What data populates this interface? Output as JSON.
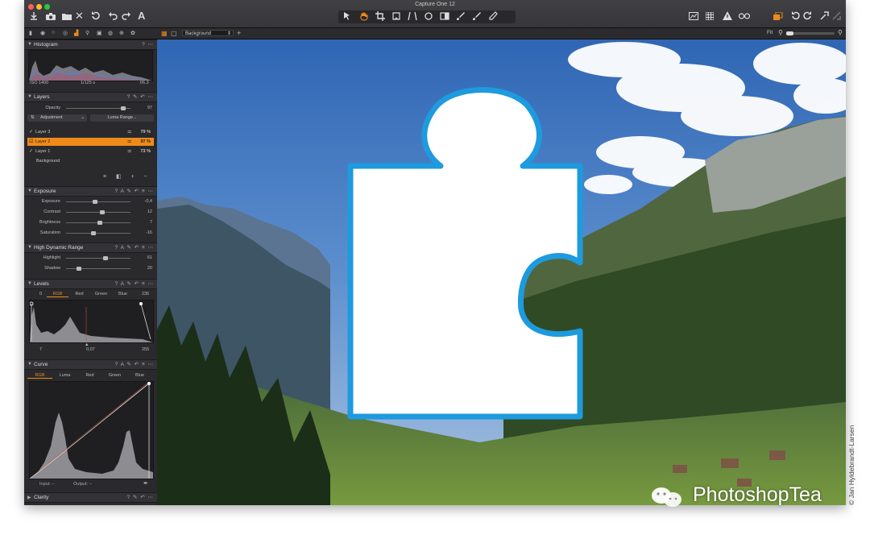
{
  "window": {
    "title": "Capture One 12"
  },
  "viewer": {
    "layer_select": "Background",
    "zoom_label": "Fit"
  },
  "panels": {
    "histogram": {
      "title": "Histogram",
      "iso": "ISO 1400",
      "shutter": "1/125 s",
      "aperture": "f/6.3"
    },
    "layers": {
      "title": "Layers",
      "opacity_label": "Opacity",
      "opacity_value": "97",
      "adjustment_label": "Adjustment",
      "luma_range_label": "Luma Range...",
      "items": [
        {
          "name": "Layer 3",
          "value": "79 %",
          "selected": false
        },
        {
          "name": "Layer 2",
          "value": "97 %",
          "selected": true
        },
        {
          "name": "Layer 1",
          "value": "73 %",
          "selected": false
        },
        {
          "name": "Background",
          "value": "",
          "selected": false
        }
      ]
    },
    "exposure": {
      "title": "Exposure",
      "sliders": [
        {
          "label": "Exposure",
          "value": "-0,4",
          "pos": 0.45
        },
        {
          "label": "Contrast",
          "value": "12",
          "pos": 0.56
        },
        {
          "label": "Brightness",
          "value": "7",
          "pos": 0.53
        },
        {
          "label": "Saturation",
          "value": "-16",
          "pos": 0.42
        }
      ]
    },
    "hdr": {
      "title": "High Dynamic Range",
      "sliders": [
        {
          "label": "Highlight",
          "value": "61",
          "pos": 0.61
        },
        {
          "label": "Shadow",
          "value": "20",
          "pos": 0.2
        }
      ]
    },
    "levels": {
      "title": "Levels",
      "tabs": [
        "RGB",
        "Red",
        "Green",
        "Blue"
      ],
      "out_low": "0",
      "out_high": "236",
      "in_low": "7",
      "mid": "0,07",
      "in_high": "255"
    },
    "curve": {
      "title": "Curve",
      "tabs": [
        "RGB",
        "Luma",
        "Red",
        "Green",
        "Blue"
      ],
      "input_label": "Input:",
      "input_value": "--",
      "output_label": "Output:",
      "output_value": "--"
    },
    "clarity": {
      "title": "Clarity"
    }
  },
  "credit": "© Jan Hyldebrandt-Larsen",
  "watermark": "PhotoshopTea",
  "colors": {
    "accent": "#ee8a1a",
    "puzzle_border": "#1e9ade"
  }
}
